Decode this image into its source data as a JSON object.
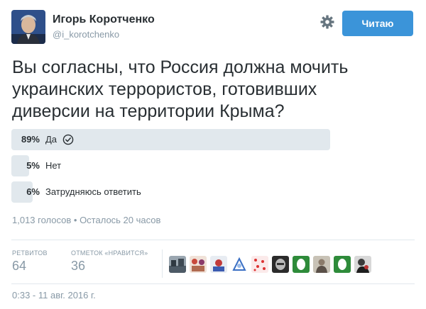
{
  "author": {
    "name": "Игорь Коротченко",
    "handle": "@i_korotchenko",
    "follow_label": "Читаю"
  },
  "tweet": {
    "lines": [
      "Вы согласны, что Россия должна мочить",
      "украинских террористов, готовивших",
      "диверсии на территории Крыма?"
    ]
  },
  "poll": {
    "options": [
      {
        "percent_label": "89%",
        "label": "Да",
        "fraction": 0.89,
        "selected": true
      },
      {
        "percent_label": "5%",
        "label": "Нет",
        "fraction": 0.05,
        "selected": false
      },
      {
        "percent_label": "6%",
        "label": "Затрудняюсь ответить",
        "fraction": 0.06,
        "selected": false
      }
    ],
    "meta": "1,013 голосов • Осталось 20 часов"
  },
  "stats": {
    "retweets_label": "РЕТВИТОВ",
    "retweets_value": "64",
    "likes_label": "ОТМЕТОК «НРАВИТСЯ»",
    "likes_value": "36"
  },
  "timestamp": "0:33 - 11 авг. 2016 г.",
  "colors": {
    "accent": "#3b94d9",
    "poll_bar": "#e1e8ed",
    "muted": "#8899a6",
    "text": "#292f33"
  }
}
